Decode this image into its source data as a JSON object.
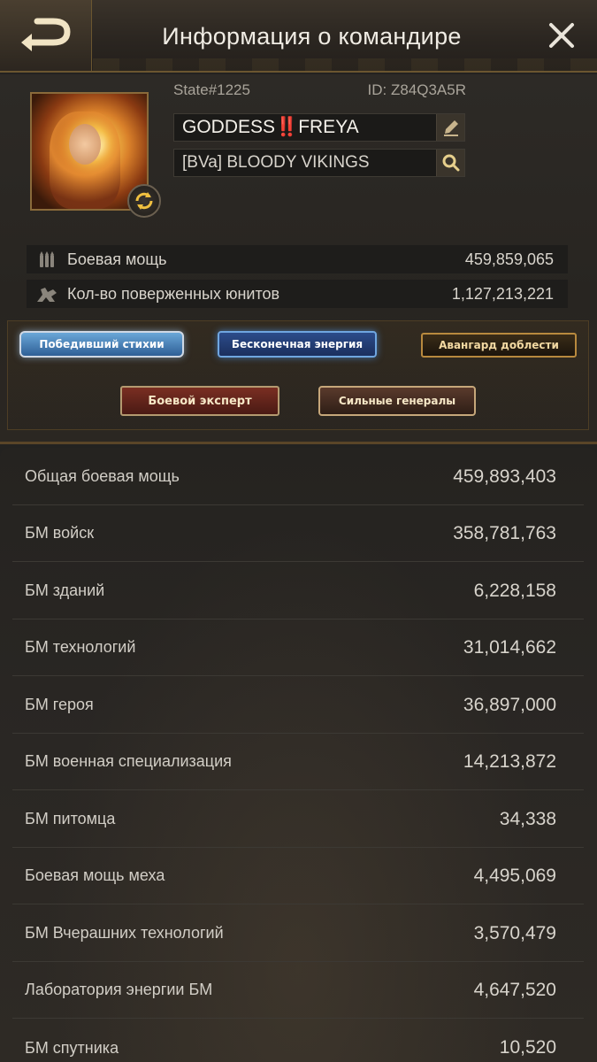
{
  "header": {
    "title": "Информация о командире"
  },
  "profile": {
    "state": "State#1225",
    "id": "ID: Z84Q3A5R",
    "name_parts": [
      "GODDESS",
      "‼️",
      "FREYA"
    ],
    "alliance": "[BVa] BLOODY VIKINGS",
    "stats": [
      {
        "label": "Боевая мощь",
        "value": "459,859,065",
        "icon": "bullets-icon"
      },
      {
        "label": "Кол-во поверженных юнитов",
        "value": "1,127,213,221",
        "icon": "defeated-soldier-icon"
      }
    ],
    "badges": [
      "Победивший стихии",
      "Бесконечная энергия",
      "Авангард доблести",
      "Боевой эксперт",
      "Сильные генералы"
    ]
  },
  "power_list": [
    {
      "label": "Общая боевая мощь",
      "value": "459,893,403"
    },
    {
      "label": "БМ войск",
      "value": "358,781,763"
    },
    {
      "label": "БМ зданий",
      "value": "6,228,158"
    },
    {
      "label": "БМ технологий",
      "value": "31,014,662"
    },
    {
      "label": "БМ героя",
      "value": "36,897,000"
    },
    {
      "label": "БМ военная специализация",
      "value": "14,213,872"
    },
    {
      "label": "БМ питомца",
      "value": "34,338"
    },
    {
      "label": "Боевая мощь меха",
      "value": "4,495,069"
    },
    {
      "label": "БМ Вчерашних технологий",
      "value": "3,570,479"
    },
    {
      "label": "Лаборатория энергии БМ",
      "value": "4,647,520"
    },
    {
      "label": "БМ спутника",
      "value": "10,520"
    }
  ],
  "colors": {
    "accent_gold": "#b8893e",
    "background": "#232220"
  }
}
